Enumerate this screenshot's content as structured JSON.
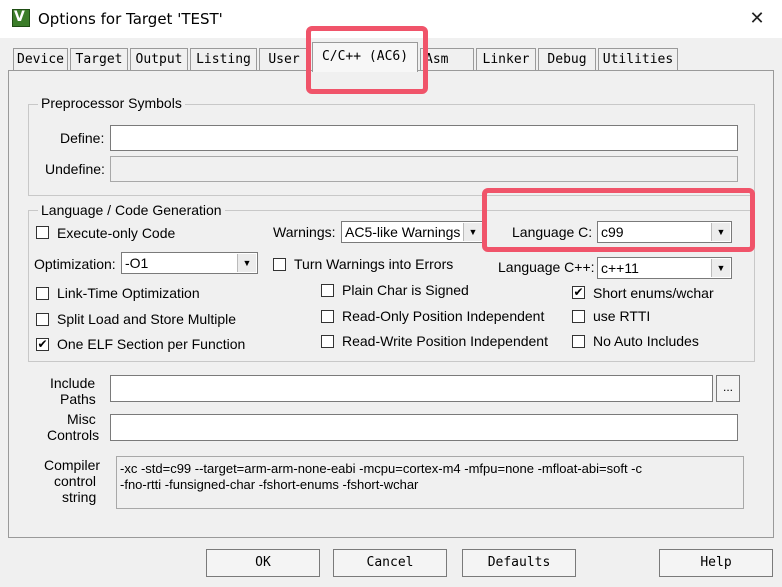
{
  "window": {
    "title": "Options for Target 'TEST'",
    "close": "✕",
    "app_icon": "V"
  },
  "tabs": [
    "Device",
    "Target",
    "Output",
    "Listing",
    "User",
    "C/C++ (AC6)",
    "Asm",
    "Linker",
    "Debug",
    "Utilities"
  ],
  "active_tab": "C/C++ (AC6)",
  "preprocessor": {
    "group_label": "Preprocessor Symbols",
    "define_label": "Define:",
    "define_value": "",
    "undefine_label": "Undefine:",
    "undefine_value": ""
  },
  "codegen": {
    "group_label": "Language / Code Generation",
    "execute_only": {
      "label": "Execute-only Code",
      "checked": false
    },
    "optimization_label": "Optimization:",
    "optimization_value": "-O1",
    "link_time": {
      "label": "Link-Time Optimization",
      "checked": false
    },
    "split_load": {
      "label": "Split Load and Store Multiple",
      "checked": false
    },
    "one_elf": {
      "label": "One ELF Section per Function",
      "checked": true
    },
    "warnings_label": "Warnings:",
    "warnings_value": "AC5-like Warnings",
    "turn_warnings": {
      "label": "Turn Warnings into Errors",
      "checked": false
    },
    "plain_char": {
      "label": "Plain Char is Signed",
      "checked": false
    },
    "ropi": {
      "label": "Read-Only Position Independent",
      "checked": false
    },
    "rwpi": {
      "label": "Read-Write Position Independent",
      "checked": false
    },
    "language_c_label": "Language C:",
    "language_c_value": "c99",
    "language_cpp_label": "Language C++:",
    "language_cpp_value": "c++11",
    "short_enums": {
      "label": "Short enums/wchar",
      "checked": true
    },
    "use_rtti": {
      "label": "use RTTI",
      "checked": false
    },
    "no_auto_includes": {
      "label": "No Auto Includes",
      "checked": false
    }
  },
  "paths": {
    "include_label_1": "Include",
    "include_label_2": "Paths",
    "include_value": "",
    "browse": "...",
    "misc_label_1": "Misc",
    "misc_label_2": "Controls",
    "misc_value": ""
  },
  "compiler": {
    "label_1": "Compiler",
    "label_2": "control",
    "label_3": "string",
    "value": "-xc -std=c99 --target=arm-arm-none-eabi -mcpu=cortex-m4 -mfpu=none -mfloat-abi=soft -c\n-fno-rtti -funsigned-char -fshort-enums -fshort-wchar"
  },
  "buttons": {
    "ok": "OK",
    "cancel": "Cancel",
    "defaults": "Defaults",
    "help": "Help"
  },
  "colors": {
    "highlight": "#f0546a",
    "background": "#f0f0f0"
  }
}
